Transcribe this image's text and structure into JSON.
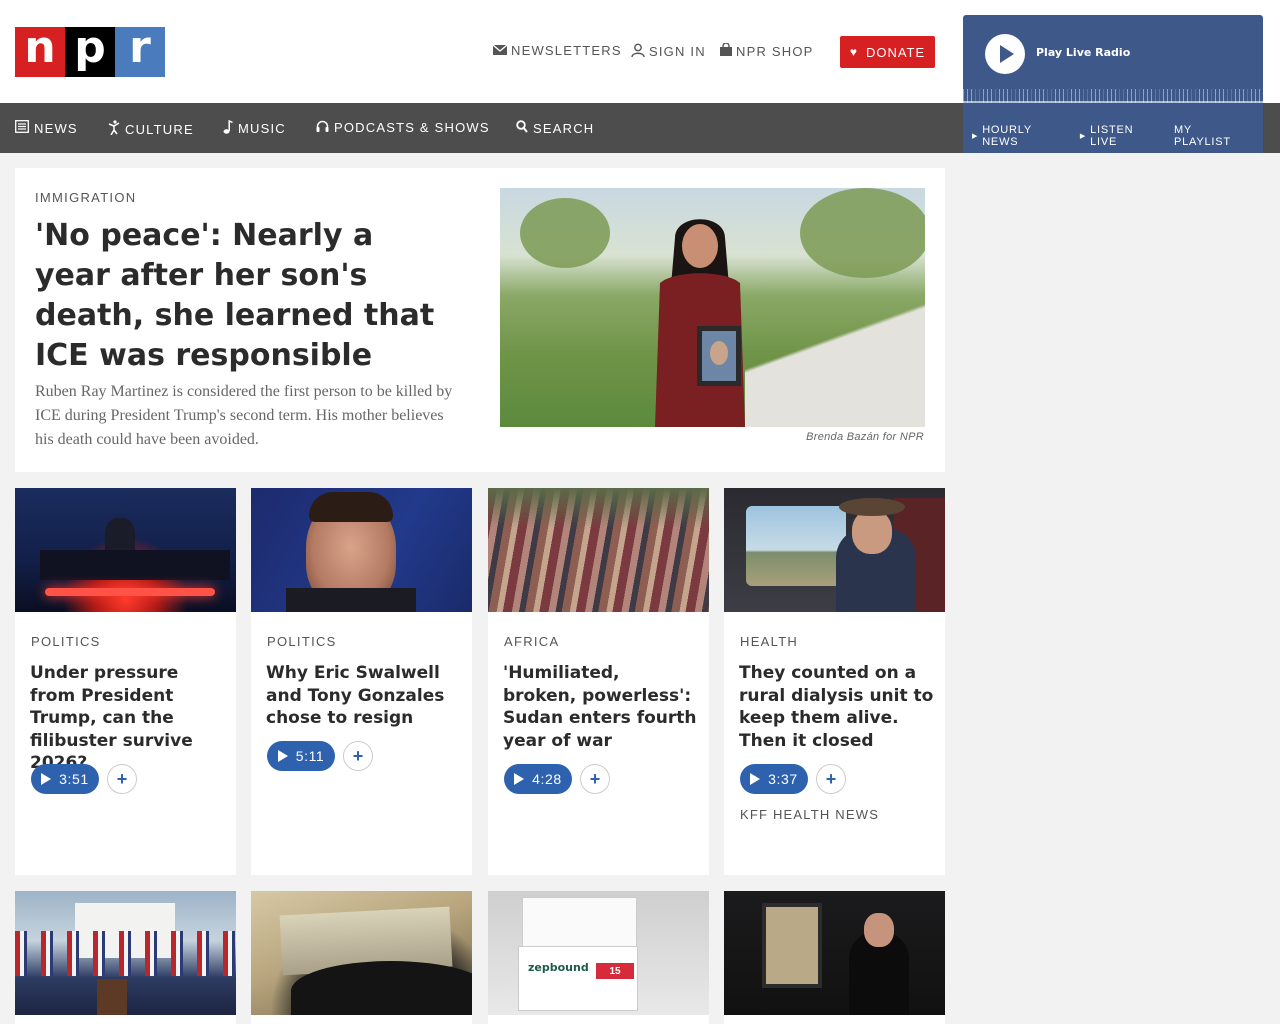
{
  "header": {
    "logo_letters": [
      "n",
      "p",
      "r"
    ],
    "utility": {
      "newsletters": "NEWSLETTERS",
      "sign_in": "SIGN IN",
      "shop": "NPR SHOP"
    },
    "donate_label": "DONATE"
  },
  "player": {
    "play_label": "Play Live Radio",
    "links": [
      "HOURLY NEWS",
      "LISTEN LIVE",
      "MY PLAYLIST"
    ]
  },
  "nav": {
    "items": [
      "NEWS",
      "CULTURE",
      "MUSIC",
      "PODCASTS & SHOWS",
      "SEARCH"
    ]
  },
  "featured": {
    "slug": "IMMIGRATION",
    "title": "'No peace': Nearly a year after her son's death, she learned that ICE was responsible",
    "teaser": "Ruben Ray Martinez is considered the first person to be killed by ICE during President Trump's second term. His mother believes his death could have been avoided.",
    "credit": "Brenda Bazán for NPR"
  },
  "cards": [
    {
      "slug": "POLITICS",
      "title": "Under pressure from President Trump, can the filibuster survive 2026?",
      "duration": "3:51"
    },
    {
      "slug": "POLITICS",
      "title": "Why Eric Swalwell and Tony Gonzales chose to resign",
      "duration": "5:11"
    },
    {
      "slug": "AFRICA",
      "title": "'Humiliated, broken, powerless': Sudan enters fourth year of war",
      "duration": "4:28"
    },
    {
      "slug": "HEALTH",
      "title": "They counted on a rural dialysis unit to keep them alive. Then it closed",
      "duration": "3:37",
      "source": "KFF HEALTH NEWS"
    }
  ],
  "row2_labels": {
    "package_brand": "zepbound",
    "package_dose": "15"
  },
  "colors": {
    "npr_red": "#d62021",
    "npr_black": "#000000",
    "npr_blue": "#4a7bbd",
    "player_blue": "#3e5889",
    "nav_gray": "#4d4d4d",
    "audio_blue": "#2e62ae"
  }
}
